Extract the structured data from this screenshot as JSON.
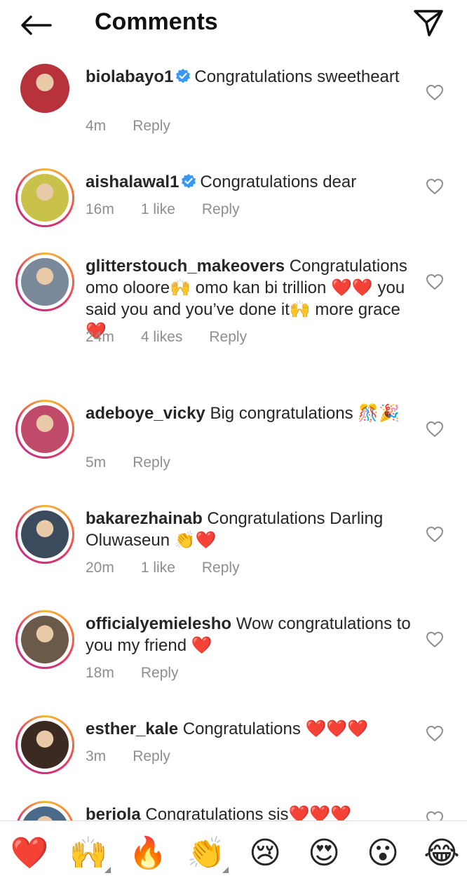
{
  "header": {
    "title": "Comments",
    "back_icon": "arrow-left-icon",
    "send_icon": "paper-plane-icon"
  },
  "comments": [
    {
      "username": "biolabayo1",
      "verified": true,
      "text": "Congratulations sweetheart",
      "time": "4m",
      "likes": "",
      "reply": "Reply",
      "ring": false,
      "avatar_color": "#b8323c"
    },
    {
      "username": "aishalawal1",
      "verified": true,
      "text": "Congratulations dear",
      "time": "16m",
      "likes": "1 like",
      "reply": "Reply",
      "ring": true,
      "avatar_color": "#c9c24a"
    },
    {
      "username": "glitterstouch_makeovers",
      "verified": false,
      "text": "Congratulations omo oloore🙌 omo kan bi trillion ❤️❤️ you said you and you’ve done it🙌 more grace❤️",
      "time": "24m",
      "likes": "4 likes",
      "reply": "Reply",
      "ring": true,
      "avatar_color": "#7a8a9a"
    },
    {
      "username": "adeboye_vicky",
      "verified": false,
      "text": "Big congratulations 🎊🎉",
      "time": "5m",
      "likes": "",
      "reply": "Reply",
      "ring": true,
      "avatar_color": "#c04a6a"
    },
    {
      "username": "bakarezhainab",
      "verified": false,
      "text": "Congratulations Darling Oluwaseun 👏❤️",
      "time": "20m",
      "likes": "1 like",
      "reply": "Reply",
      "ring": true,
      "avatar_color": "#3b4a5c"
    },
    {
      "username": "officialyemielesho",
      "verified": false,
      "text": "Wow congratulations to you my friend ❤️",
      "time": "18m",
      "likes": "",
      "reply": "Reply",
      "ring": true,
      "avatar_color": "#6b5a4a"
    },
    {
      "username": "esther_kale",
      "verified": false,
      "text": "Congratulations ❤️❤️❤️",
      "time": "3m",
      "likes": "",
      "reply": "Reply",
      "ring": true,
      "avatar_color": "#3a2a22"
    },
    {
      "username": "beriola",
      "verified": false,
      "text": "Congratulations sis❤️❤️❤️",
      "time": "",
      "likes": "",
      "reply": "",
      "ring": true,
      "avatar_color": "#4a6a8a"
    }
  ],
  "emoji_bar": [
    "❤️",
    "🙌",
    "🔥",
    "👏",
    "😢",
    "😍",
    "😮",
    "😂"
  ],
  "colors": {
    "text": "#262626",
    "meta": "#8e8e8e",
    "verified": "#3897f0",
    "heart": "#e0282c"
  }
}
